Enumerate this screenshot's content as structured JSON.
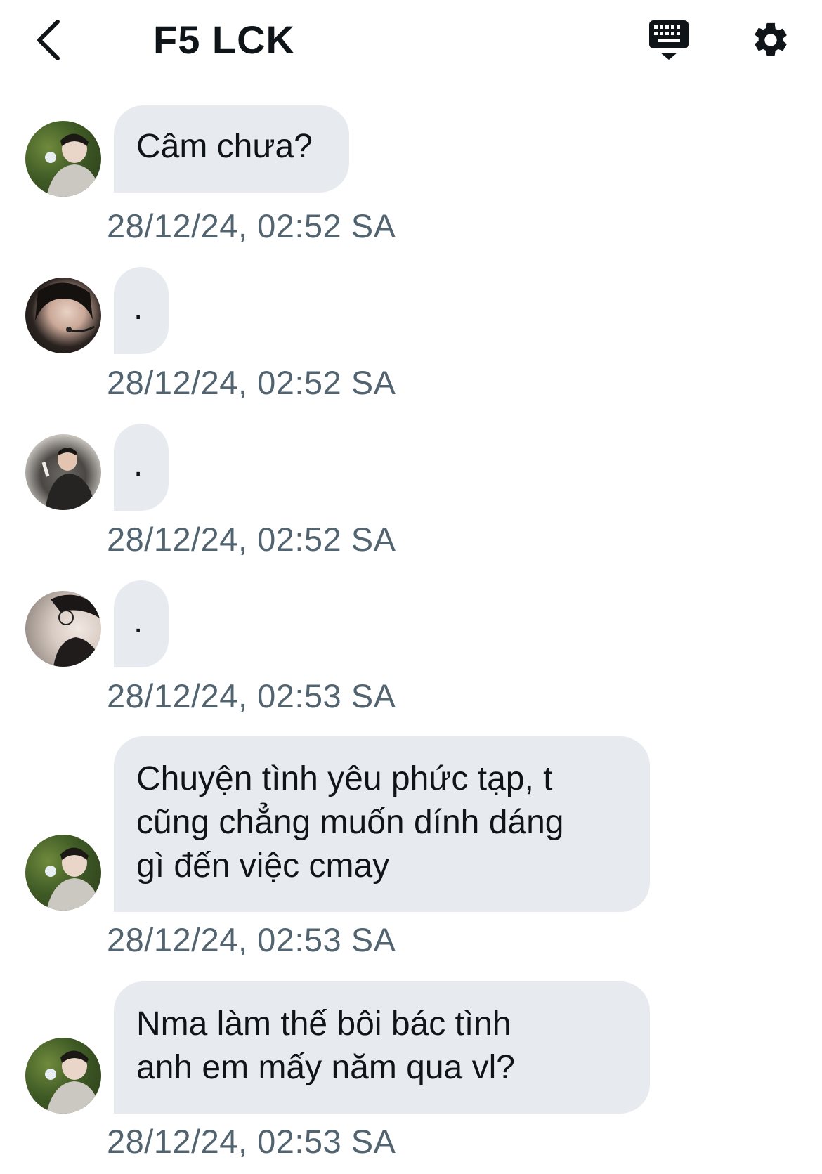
{
  "header": {
    "title": "F5 LCK",
    "back_icon": "chevron-left-icon",
    "keyboard_icon": "keyboard-hide-icon",
    "settings_icon": "gear-icon"
  },
  "messages": [
    {
      "avatar": "avatar-user-a",
      "text": "Câm chưa?",
      "timestamp": "28/12/24, 02:52 SA"
    },
    {
      "avatar": "avatar-user-b",
      "text": ".",
      "timestamp": "28/12/24, 02:52 SA"
    },
    {
      "avatar": "avatar-user-c",
      "text": ".",
      "timestamp": "28/12/24, 02:52 SA"
    },
    {
      "avatar": "avatar-user-d",
      "text": ".",
      "timestamp": "28/12/24, 02:53 SA"
    },
    {
      "avatar": "avatar-user-a",
      "lines": [
        "Chuyện tình yêu phức tạp, t",
        "cũng chẳng muốn dính dáng",
        "gì đến việc cmay"
      ],
      "timestamp": "28/12/24, 02:53 SA"
    },
    {
      "avatar": "avatar-user-a",
      "lines": [
        "Nma làm thế bôi bác tình",
        "anh em mấy năm qua vl?"
      ],
      "timestamp": "28/12/24, 02:53 SA"
    }
  ],
  "colors": {
    "bubble": "#e7ebef",
    "timestamp": "#536471",
    "text": "#0f1419"
  }
}
